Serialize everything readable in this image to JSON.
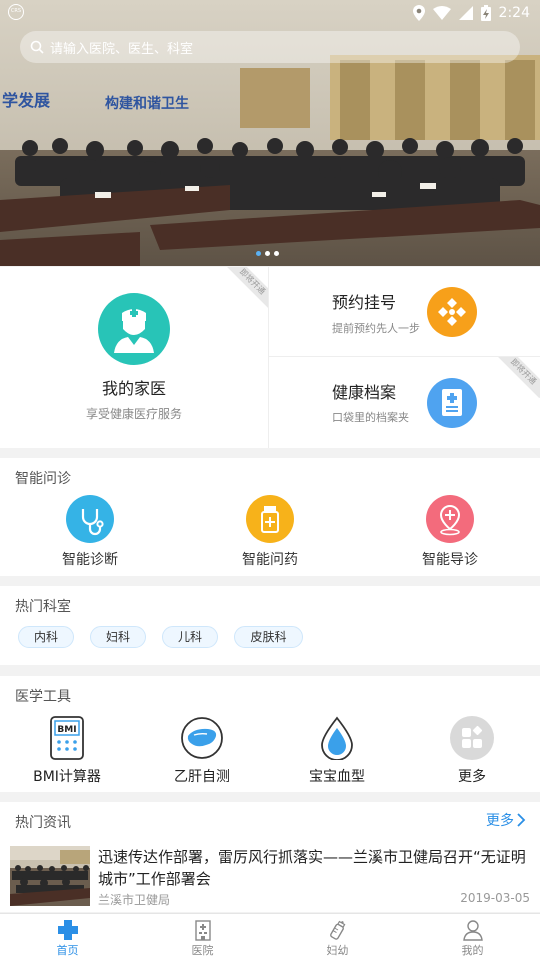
{
  "status_bar": {
    "time": "2:24"
  },
  "search": {
    "placeholder": "请输入医院、医生、科室"
  },
  "banner": {
    "wall_text_left": "学发展",
    "wall_text_right": "构建和谐卫生",
    "slide_count": 3,
    "active_slide": 1
  },
  "features": {
    "family_doctor": {
      "title": "我的家医",
      "subtitle": "享受健康医疗服务",
      "tag": "即将开通"
    },
    "appointment": {
      "title": "预约挂号",
      "subtitle": "提前预约先人一步"
    },
    "health_record": {
      "title": "健康档案",
      "subtitle": "口袋里的档案夹",
      "tag": "即将开通"
    }
  },
  "smart_consult": {
    "title": "智能问诊",
    "items": [
      {
        "label": "智能诊断",
        "icon": "stethoscope-icon",
        "color": "#35b3e6"
      },
      {
        "label": "智能问药",
        "icon": "medicine-bottle-icon",
        "color": "#f7b21a"
      },
      {
        "label": "智能导诊",
        "icon": "location-plus-icon",
        "color": "#f36b7c"
      }
    ]
  },
  "hot_departments": {
    "title": "热门科室",
    "items": [
      "内科",
      "妇科",
      "儿科",
      "皮肤科"
    ]
  },
  "medical_tools": {
    "title": "医学工具",
    "items": [
      {
        "label": "BMI计算器",
        "icon": "bmi-calculator-icon",
        "icon_text": "BMI"
      },
      {
        "label": "乙肝自测",
        "icon": "liver-icon"
      },
      {
        "label": "宝宝血型",
        "icon": "blood-drop-icon"
      },
      {
        "label": "更多",
        "icon": "more-grid-icon"
      }
    ]
  },
  "news": {
    "title": "热门资讯",
    "more": "更多",
    "items": [
      {
        "title": "迅速传达作部署，雷厉风行抓落实——兰溪市卫健局召开“无证明城市”工作部署会",
        "source": "兰溪市卫健局",
        "date": "2019-03-05"
      }
    ]
  },
  "tabbar": {
    "items": [
      {
        "label": "首页",
        "icon": "home-plus-icon",
        "active": true
      },
      {
        "label": "医院",
        "icon": "hospital-building-icon",
        "active": false
      },
      {
        "label": "妇幼",
        "icon": "baby-bottle-icon",
        "active": false
      },
      {
        "label": "我的",
        "icon": "user-icon",
        "active": false
      }
    ]
  },
  "colors": {
    "accent": "#2b8fe6",
    "family_avatar": "#28c4b7",
    "appointment_icon": "#f7a01a",
    "record_icon": "#4fa3f0"
  }
}
